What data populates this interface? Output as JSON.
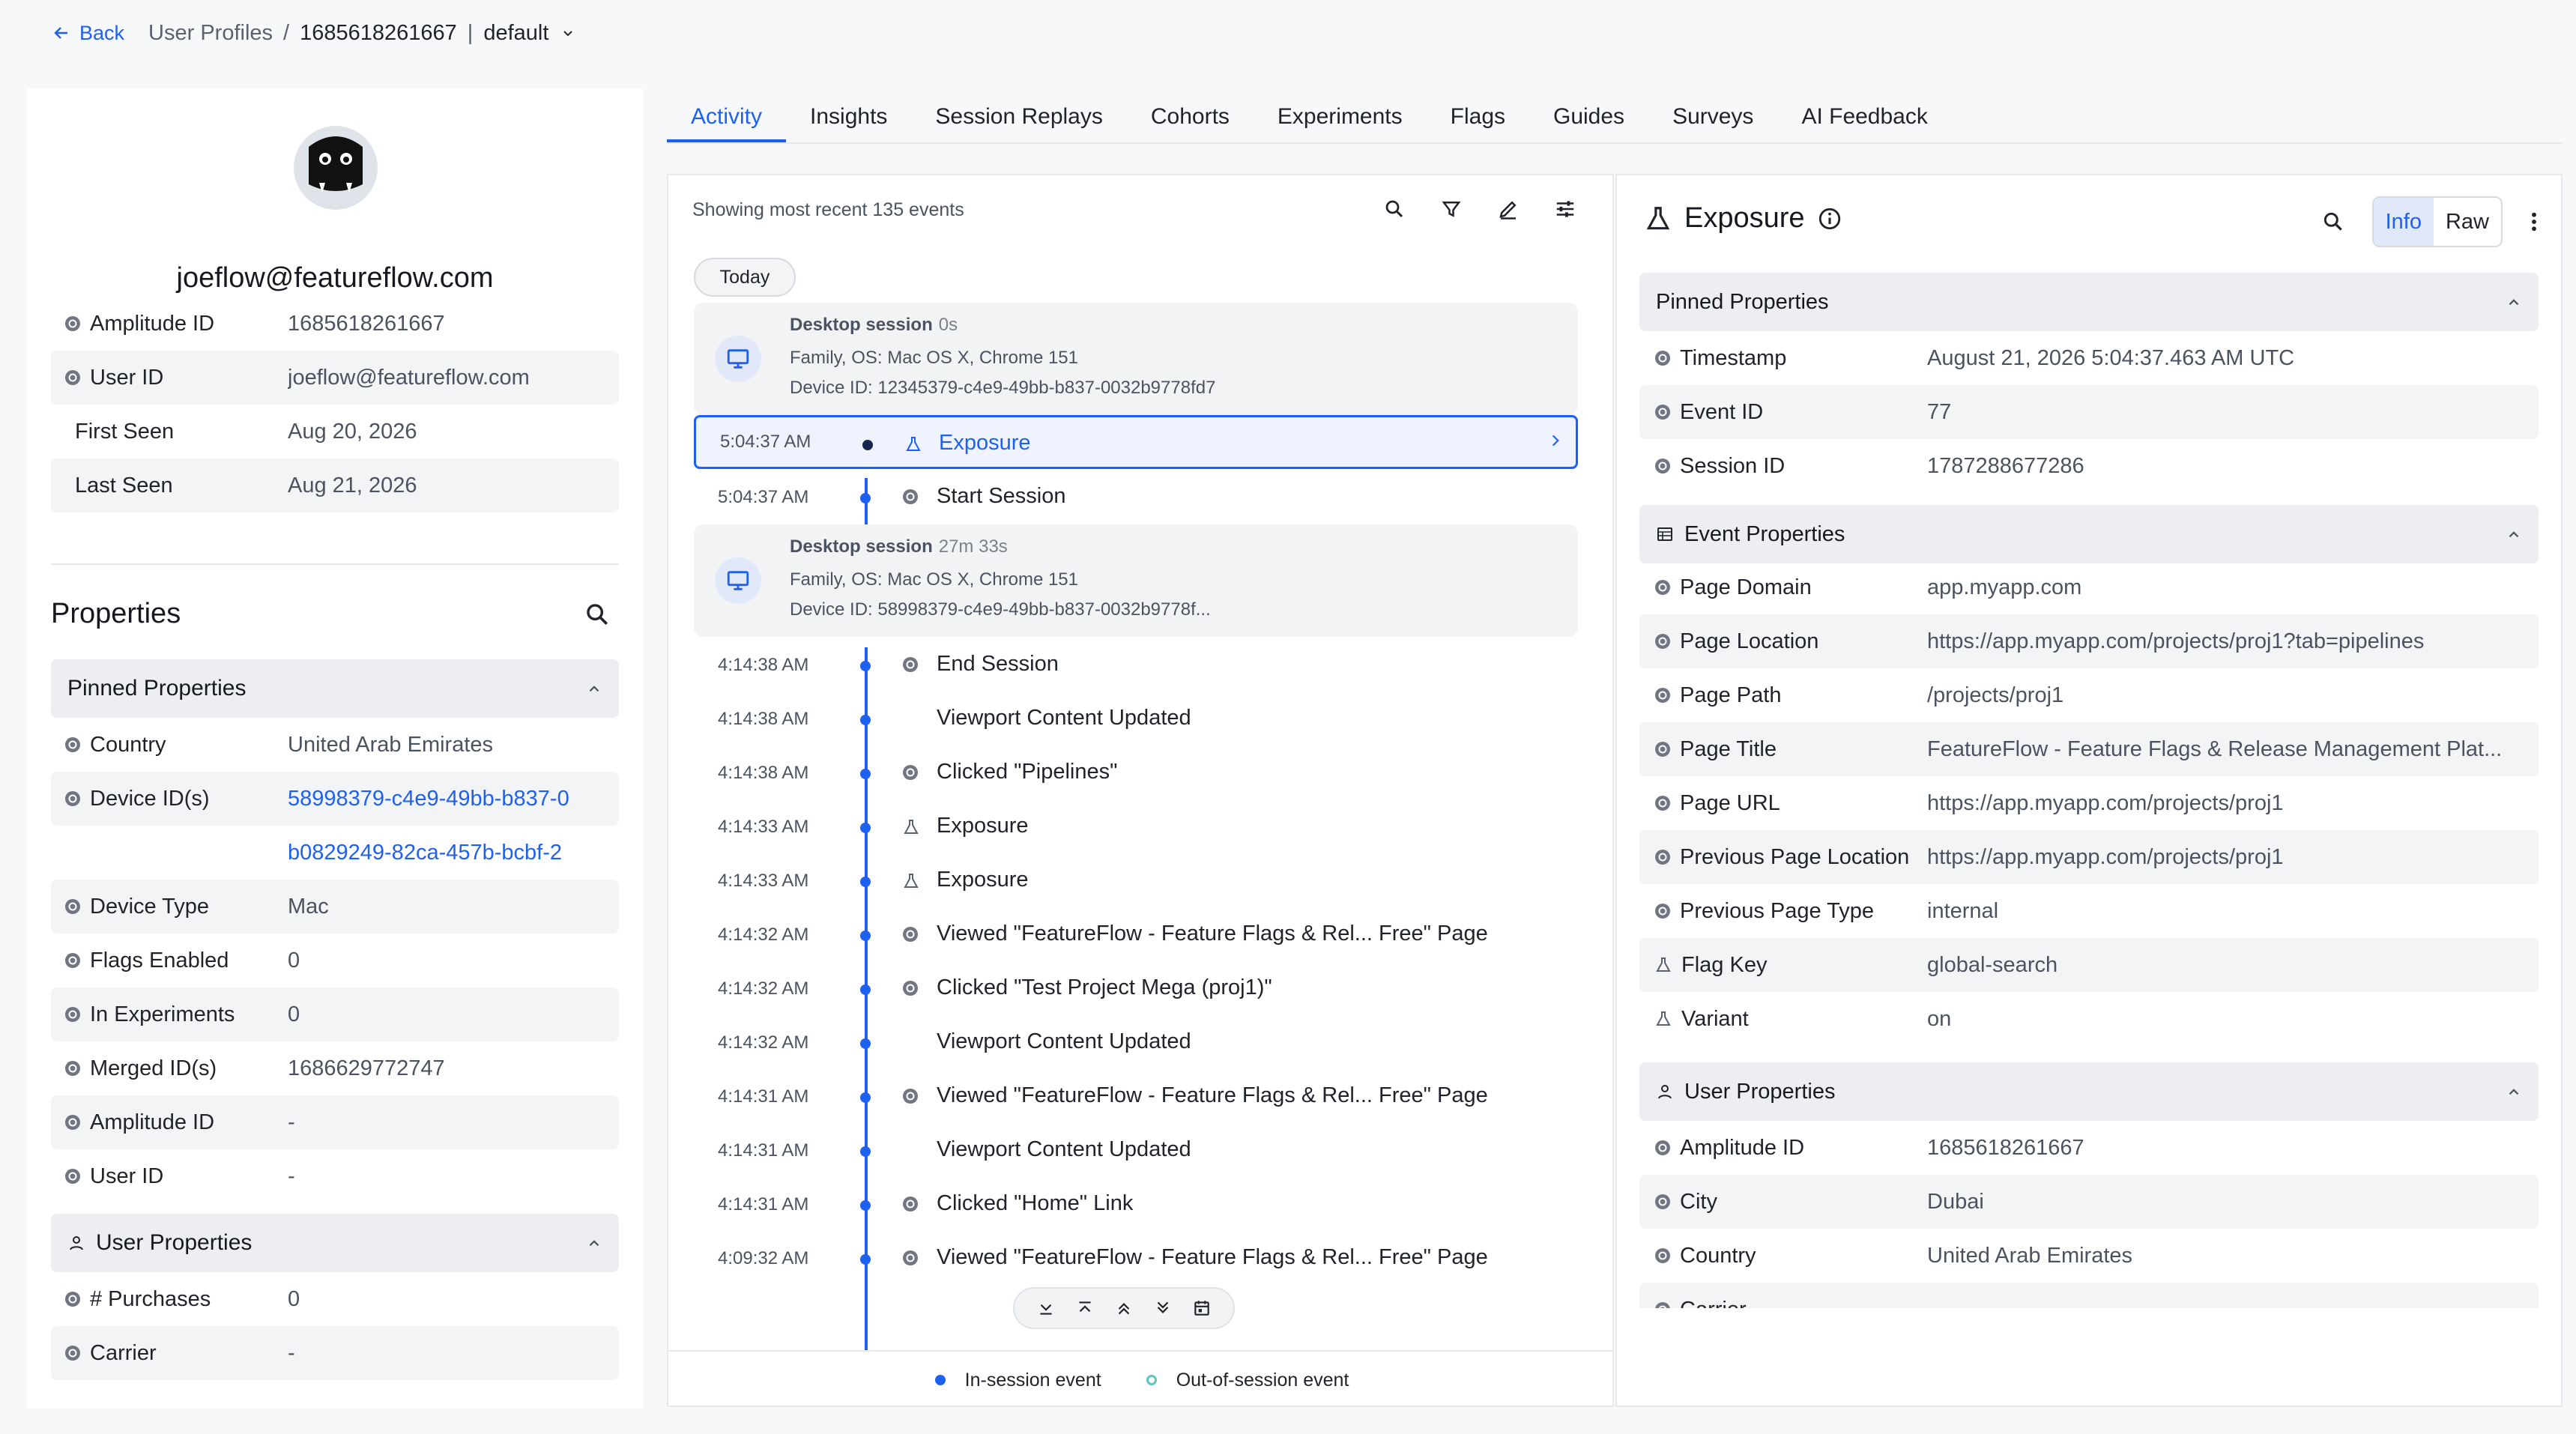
{
  "breadcrumb": {
    "back": "Back",
    "section": "User Profiles",
    "sep": "/",
    "user_id": "1685618261667",
    "pipe": "|",
    "project": "default"
  },
  "profile": {
    "email": "joeflow@featureflow.com",
    "summary": [
      {
        "label": "Amplitude ID",
        "value": "1685618261667",
        "icon": true
      },
      {
        "label": "User ID",
        "value": "joeflow@featureflow.com",
        "icon": true
      },
      {
        "label": "First Seen",
        "value": "Aug 20, 2026",
        "icon": false
      },
      {
        "label": "Last Seen",
        "value": "Aug 21, 2026",
        "icon": false
      }
    ],
    "properties_title": "Properties",
    "pinned_title": "Pinned Properties",
    "pinned": [
      {
        "label": "Country",
        "value": "United Arab Emirates"
      },
      {
        "label": "Device ID(s)",
        "value": "58998379-c4e9-49bb-b837-0"
      },
      {
        "label": "",
        "value": "b0829249-82ca-457b-bcbf-2"
      },
      {
        "label": "Device Type",
        "value": "Mac"
      },
      {
        "label": "Flags Enabled",
        "value": "0"
      },
      {
        "label": "In Experiments",
        "value": "0"
      },
      {
        "label": "Merged ID(s)",
        "value": "1686629772747"
      },
      {
        "label": "Amplitude ID",
        "value": "-"
      },
      {
        "label": "User ID",
        "value": "-"
      }
    ],
    "user_props_title": "User Properties",
    "user_props": [
      {
        "label": "# Purchases",
        "value": "0"
      },
      {
        "label": "Carrier",
        "value": "-"
      }
    ]
  },
  "tabs": [
    "Activity",
    "Insights",
    "Session Replays",
    "Cohorts",
    "Experiments",
    "Flags",
    "Guides",
    "Surveys",
    "AI Feedback"
  ],
  "activity": {
    "showing": "Showing most recent 135 events",
    "today": "Today",
    "sessions": [
      {
        "title": "Desktop session",
        "duration": "0s",
        "line2": "Family, OS: Mac OS X, Chrome 151",
        "line3": "Device ID: 12345379-c4e9-49bb-b837-0032b9778fd7"
      },
      {
        "title": "Desktop session",
        "duration": "27m 33s",
        "line2": "Family, OS: Mac OS X, Chrome 151",
        "line3": "Device ID: 58998379-c4e9-49bb-b837-0032b9778f..."
      }
    ],
    "events_a": [
      {
        "time": "5:04:37 AM",
        "name": "Exposure",
        "icon": "flask"
      },
      {
        "time": "5:04:37 AM",
        "name": "Start Session",
        "icon": "globe"
      }
    ],
    "events_b": [
      {
        "time": "4:14:38 AM",
        "name": "End Session",
        "icon": "globe"
      },
      {
        "time": "4:14:38 AM",
        "name": "Viewport Content Updated",
        "icon": ""
      },
      {
        "time": "4:14:38 AM",
        "name": "Clicked \"Pipelines\"",
        "icon": "globe"
      },
      {
        "time": "4:14:33 AM",
        "name": "Exposure",
        "icon": "flask"
      },
      {
        "time": "4:14:33 AM",
        "name": "Exposure",
        "icon": "flask"
      },
      {
        "time": "4:14:32 AM",
        "name": "Viewed \"FeatureFlow - Feature Flags & Rel... Free\" Page",
        "icon": "globe"
      },
      {
        "time": "4:14:32 AM",
        "name": "Clicked \"Test Project Mega (proj1)\"",
        "icon": "globe"
      },
      {
        "time": "4:14:32 AM",
        "name": "Viewport Content Updated",
        "icon": ""
      },
      {
        "time": "4:14:31 AM",
        "name": "Viewed \"FeatureFlow - Feature Flags & Rel... Free\" Page",
        "icon": "globe"
      },
      {
        "time": "4:14:31 AM",
        "name": "Viewport Content Updated",
        "icon": ""
      },
      {
        "time": "4:14:31 AM",
        "name": "Clicked \"Home\" Link",
        "icon": "globe"
      },
      {
        "time": "4:09:32 AM",
        "name": "Viewed \"FeatureFlow - Feature Flags & Rel... Free\" Page",
        "icon": "globe"
      }
    ],
    "legend_in": "In-session event",
    "legend_out": "Out-of-session event"
  },
  "detail": {
    "title": "Exposure",
    "info": "Info",
    "raw": "Raw",
    "pinned_title": "Pinned Properties",
    "pinned": [
      {
        "label": "Timestamp",
        "value": "August 21, 2026 5:04:37.463 AM UTC",
        "icon": "globe"
      },
      {
        "label": "Event ID",
        "value": "77",
        "icon": "globe"
      },
      {
        "label": "Session ID",
        "value": "1787288677286",
        "icon": "globe"
      }
    ],
    "event_title": "Event Properties",
    "event": [
      {
        "label": "Page Domain",
        "value": "app.myapp.com",
        "icon": "globe"
      },
      {
        "label": "Page Location",
        "value": "https://app.myapp.com/projects/proj1?tab=pipelines",
        "icon": "globe"
      },
      {
        "label": "Page Path",
        "value": "/projects/proj1",
        "icon": "globe"
      },
      {
        "label": "Page Title",
        "value": "FeatureFlow - Feature Flags & Release Management Plat...",
        "icon": "globe"
      },
      {
        "label": "Page URL",
        "value": "https://app.myapp.com/projects/proj1",
        "icon": "globe"
      },
      {
        "label": "Previous Page Location",
        "value": "https://app.myapp.com/projects/proj1",
        "icon": "globe"
      },
      {
        "label": "Previous Page Type",
        "value": "internal",
        "icon": "globe"
      },
      {
        "label": "Flag Key",
        "value": "global-search",
        "icon": "flask"
      },
      {
        "label": "Variant",
        "value": "on",
        "icon": "flask"
      }
    ],
    "user_title": "User Properties",
    "user": [
      {
        "label": "Amplitude ID",
        "value": "1685618261667",
        "icon": "globe"
      },
      {
        "label": "City",
        "value": "Dubai",
        "icon": "globe"
      },
      {
        "label": "Country",
        "value": "United Arab Emirates",
        "icon": "globe"
      },
      {
        "label": "Carrier",
        "value": "",
        "icon": "globe"
      }
    ]
  },
  "colors": {
    "accent": "#1e61f0",
    "out_of_session": "#5bc4c4"
  }
}
